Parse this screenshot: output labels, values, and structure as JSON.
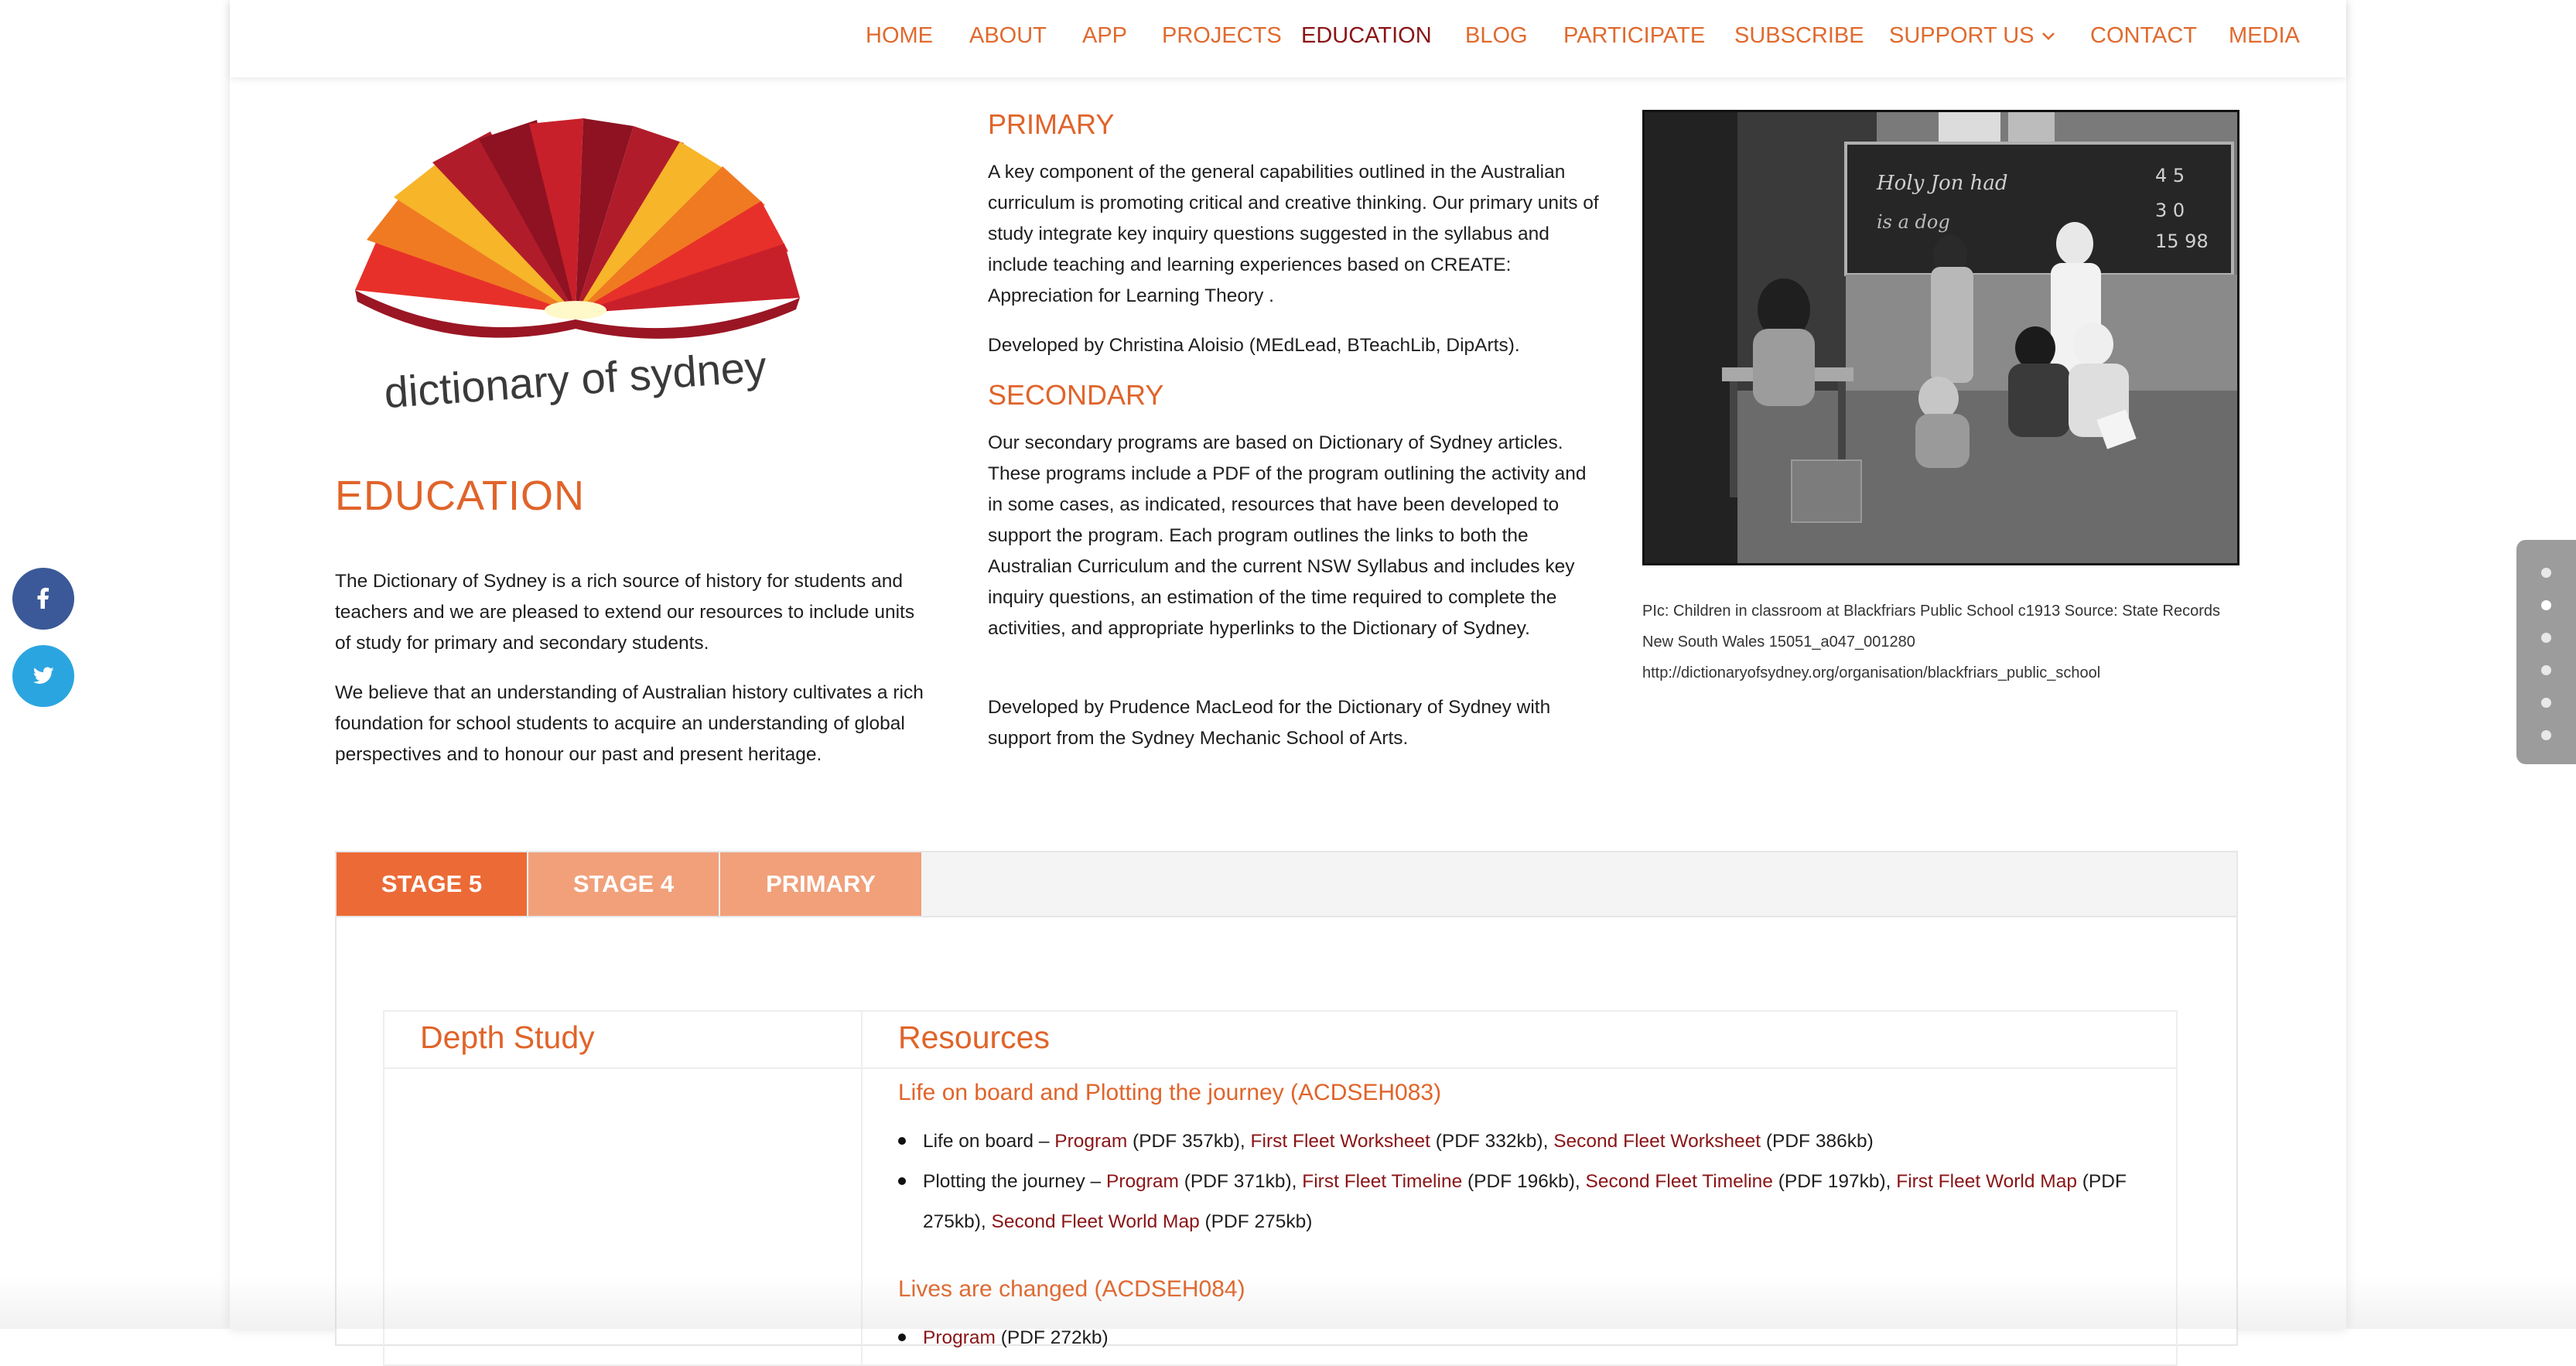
{
  "nav": {
    "items": [
      {
        "label": "HOME"
      },
      {
        "label": "ABOUT"
      },
      {
        "label": "APP"
      },
      {
        "label": "PROJECTS"
      },
      {
        "label": "EDUCATION",
        "active": true
      },
      {
        "label": "BLOG"
      },
      {
        "label": "PARTICIPATE"
      },
      {
        "label": "SUBSCRIBE"
      },
      {
        "label": "SUPPORT US"
      },
      {
        "label": "CONTACT"
      },
      {
        "label": "MEDIA"
      }
    ]
  },
  "logo": {
    "text": "dictionary of sydney"
  },
  "education": {
    "title": "EDUCATION",
    "p1": "The Dictionary of Sydney is a rich source of history for students and teachers and we are pleased to extend our resources to include units of study for primary and secondary students.",
    "p2": "We believe that an understanding of Australian history cultivates a rich foundation for school students to acquire an understanding of global perspectives and to honour our past and present heritage."
  },
  "primary": {
    "title": "PRIMARY",
    "p1": "A key component of the general capabilities outlined in the Australian curriculum is promoting critical and creative thinking. Our primary units of study integrate key inquiry questions suggested in the syllabus and include teaching and learning experiences based on CREATE: Appreciation for Learning Theory .",
    "p2": "Developed by Christina Aloisio (MEdLead, BTeachLib, DipArts)."
  },
  "secondary": {
    "title": "SECONDARY",
    "p1": "Our secondary programs are based on Dictionary of Sydney articles. These programs include a PDF of the program outlining the activity and in some cases, as indicated, resources that have been developed to support the program. Each program outlines the links to both the Australian Curriculum and the current NSW Syllabus and includes key inquiry questions, an estimation of the time required to complete the activities, and appropriate hyperlinks to the Dictionary of Sydney.",
    "p2": "Developed by Prudence MacLeod for the Dictionary of Sydney with support from the Sydney Mechanic School of Arts."
  },
  "photo": {
    "caption_line1": "PIc: Children in classroom at Blackfriars Public School c1913 Source: State Records",
    "caption_line2": "New South Wales 15051_a047_001280",
    "caption_line3": "http://dictionaryofsydney.org/organisation/blackfriars_public_school"
  },
  "tabs": [
    {
      "label": "STAGE 5",
      "active": true
    },
    {
      "label": "STAGE 4"
    },
    {
      "label": "PRIMARY"
    }
  ],
  "table": {
    "col1": "Depth Study",
    "col2": "Resources",
    "section1": "Life on board and Plotting the journey (ACDSEH083)",
    "b1": {
      "prefix": "Life on board – ",
      "program": "Program",
      "program_size": " (PDF 357kb), ",
      "ffw": "First Fleet Worksheet",
      "ffw_size": " (PDF 332kb), ",
      "sfw": "Second Fleet Worksheet",
      "sfw_size": " (PDF 386kb)"
    },
    "b2": {
      "prefix": "Plotting the journey – ",
      "program": "Program",
      "program_size": " (PDF 371kb), ",
      "fft": "First Fleet Timeline",
      "fft_size": " (PDF 196kb), ",
      "sft": "Second Fleet Timeline",
      "sft_size": " (PDF 197kb), ",
      "ffm": "First Fleet World Map",
      "ffm_size": " (PDF 275kb), ",
      "sfm": "Second Fleet World Map",
      "sfm_size": " (PDF 275kb)"
    },
    "section2": "Lives are changed (ACDSEH084)",
    "b3": {
      "program": "Program",
      "program_size": " (PDF 272kb)"
    }
  },
  "social": {
    "fb_icon": "facebook-icon",
    "tw_icon": "twitter-icon"
  },
  "colors": {
    "accent": "#e0642a",
    "link": "#8a1416",
    "tab_active": "#ec6a36",
    "tab_inactive": "#f1a07a"
  }
}
